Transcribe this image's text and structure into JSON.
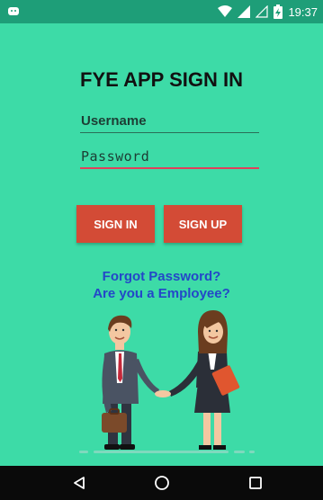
{
  "status_bar": {
    "time": "19:37",
    "icons": [
      "android-notification-icon",
      "wifi-icon",
      "signal-icon",
      "signal-empty-icon",
      "battery-charging-icon"
    ]
  },
  "login": {
    "title": "FYE APP SIGN IN",
    "username_placeholder": "Username",
    "password_placeholder": "Password",
    "signin_label": "SIGN IN",
    "signup_label": "SIGN UP",
    "forgot_password": "Forgot Password?",
    "employee_link": "Are you a Employee?"
  },
  "colors": {
    "background": "#3DDBA7",
    "status_bar": "#1E9E78",
    "button": "#D34B36",
    "link": "#2447C8",
    "password_underline": "#E0405A"
  },
  "nav_bar": {
    "icons": [
      "back-triangle-icon",
      "home-circle-icon",
      "recents-square-icon"
    ]
  }
}
